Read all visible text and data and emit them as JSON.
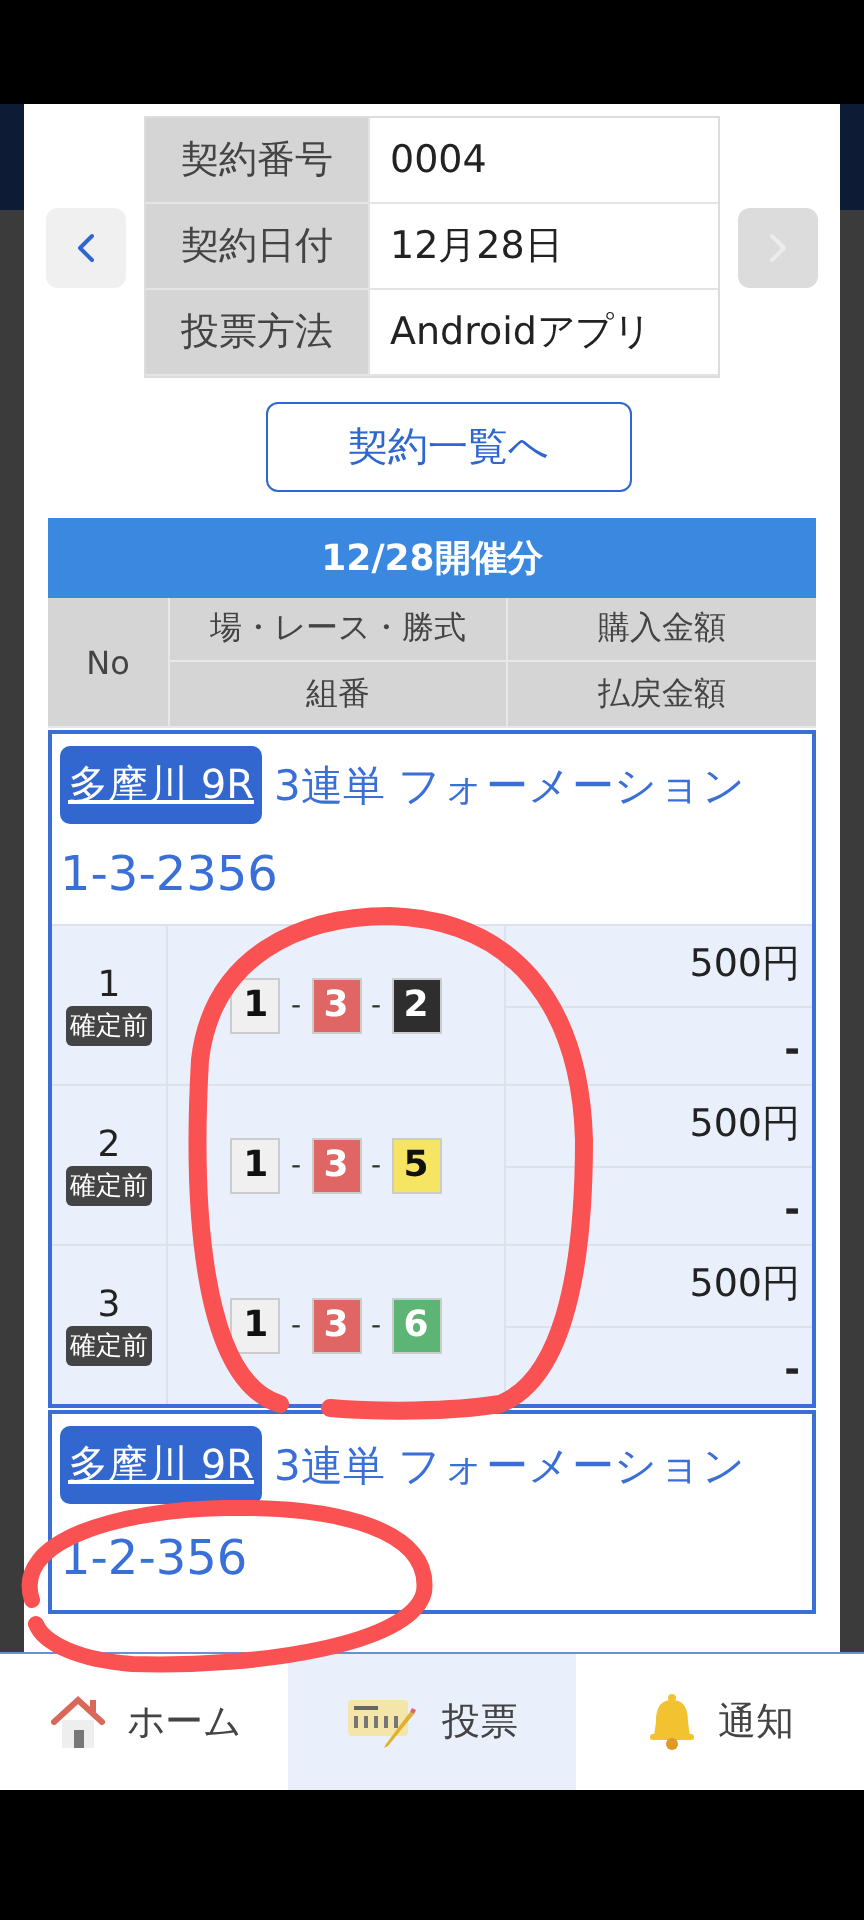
{
  "contract": {
    "rows": [
      {
        "label": "契約番号",
        "value": "0004"
      },
      {
        "label": "契約日付",
        "value": "12月28日"
      },
      {
        "label": "投票方法",
        "value": "Androidアプリ"
      }
    ]
  },
  "pager": [
    {
      "kind": "prev",
      "disabled": false
    },
    {
      "kind": "next",
      "disabled": true
    }
  ],
  "list_button": "契約一覧へ",
  "section": {
    "title": "12/28開催分",
    "headers": {
      "no": "No",
      "race": "場・レース・勝式",
      "combo": "組番",
      "purchase": "購入金額",
      "payout": "払戻金額"
    }
  },
  "races": [
    {
      "venue": "多摩川 9R",
      "bet_type": "3連単 フォーメーション",
      "combination": "1-3-2356",
      "separator": "-",
      "bets": [
        {
          "no": "1",
          "status": "確定前",
          "boats": [
            {
              "number": "1",
              "color": "#f0f0f0"
            },
            {
              "number": "3",
              "color": "#e06666"
            },
            {
              "number": "2",
              "color": "#2e2e2e"
            }
          ],
          "amount": "500円",
          "payout": "-"
        },
        {
          "no": "2",
          "status": "確定前",
          "boats": [
            {
              "number": "1",
              "color": "#f0f0f0"
            },
            {
              "number": "3",
              "color": "#e06666"
            },
            {
              "number": "5",
              "color": "#f6e463"
            }
          ],
          "amount": "500円",
          "payout": "-"
        },
        {
          "no": "3",
          "status": "確定前",
          "boats": [
            {
              "number": "1",
              "color": "#f0f0f0"
            },
            {
              "number": "3",
              "color": "#e06666"
            },
            {
              "number": "6",
              "color": "#5cb574"
            }
          ],
          "amount": "500円",
          "payout": "-"
        }
      ]
    },
    {
      "venue": "多摩川 9R",
      "bet_type": "3連単 フォーメーション",
      "combination": "1-2-356"
    }
  ],
  "nav": [
    {
      "kind": "home",
      "label": "ホーム",
      "selected": false
    },
    {
      "kind": "ballot",
      "label": "投票",
      "selected": true
    },
    {
      "kind": "bell",
      "label": "通知",
      "selected": false
    }
  ],
  "annotation": {
    "kind": "scribble"
  }
}
